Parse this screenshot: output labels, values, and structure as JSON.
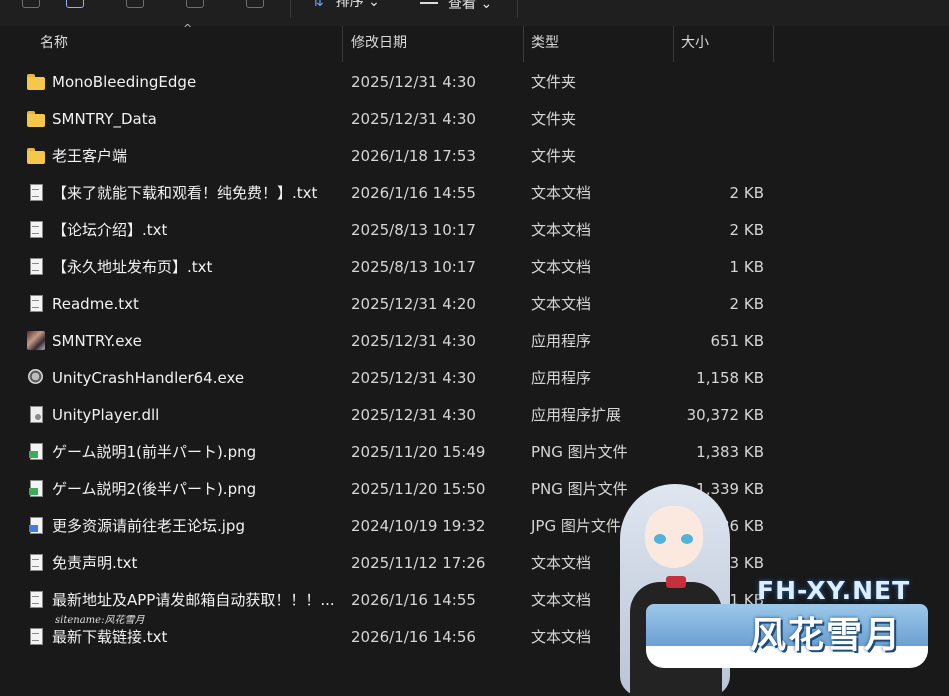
{
  "toolbar": {
    "sort_label": "排序",
    "view_label": "查看",
    "more_label": "···"
  },
  "columns": {
    "name": "名称",
    "date": "修改日期",
    "type": "类型",
    "size": "大小"
  },
  "files": [
    {
      "icon": "folder",
      "name": "MonoBleedingEdge",
      "date": "2025/12/31 4:30",
      "type": "文件夹",
      "size": ""
    },
    {
      "icon": "folder",
      "name": "SMNTRY_Data",
      "date": "2025/12/31 4:30",
      "type": "文件夹",
      "size": ""
    },
    {
      "icon": "folder",
      "name": "老王客户端",
      "date": "2026/1/18 17:53",
      "type": "文件夹",
      "size": ""
    },
    {
      "icon": "text-file",
      "name": "【来了就能下载和观看！纯免费！】.txt",
      "date": "2026/1/16 14:55",
      "type": "文本文档",
      "size": "2 KB"
    },
    {
      "icon": "text-file",
      "name": "【论坛介绍】.txt",
      "date": "2025/8/13 10:17",
      "type": "文本文档",
      "size": "2 KB"
    },
    {
      "icon": "text-file",
      "name": "【永久地址发布页】.txt",
      "date": "2025/8/13 10:17",
      "type": "文本文档",
      "size": "1 KB"
    },
    {
      "icon": "text-file",
      "name": "Readme.txt",
      "date": "2025/12/31 4:20",
      "type": "文本文档",
      "size": "2 KB"
    },
    {
      "icon": "exe",
      "name": "SMNTRY.exe",
      "date": "2025/12/31 4:30",
      "type": "应用程序",
      "size": "651 KB"
    },
    {
      "icon": "unity",
      "name": "UnityCrashHandler64.exe",
      "date": "2025/12/31 4:30",
      "type": "应用程序",
      "size": "1,158 KB"
    },
    {
      "icon": "dll",
      "name": "UnityPlayer.dll",
      "date": "2025/12/31 4:30",
      "type": "应用程序扩展",
      "size": "30,372 KB"
    },
    {
      "icon": "png",
      "name": "ゲーム説明1(前半パート).png",
      "date": "2025/11/20 15:49",
      "type": "PNG 图片文件",
      "size": "1,383 KB"
    },
    {
      "icon": "png",
      "name": "ゲーム説明2(後半パート).png",
      "date": "2025/11/20 15:50",
      "type": "PNG 图片文件",
      "size": "1,339 KB"
    },
    {
      "icon": "jpg",
      "name": "更多资源请前往老王论坛.jpg",
      "date": "2024/10/19 19:32",
      "type": "JPG 图片文件",
      "size": "86 KB"
    },
    {
      "icon": "text-file",
      "name": "免责声明.txt",
      "date": "2025/11/12 17:26",
      "type": "文本文档",
      "size": "3 KB"
    },
    {
      "icon": "text-file",
      "name": "最新地址及APP请发邮箱自动获取！！！...",
      "date": "2026/1/16 14:55",
      "type": "文本文档",
      "size": "1 KB"
    },
    {
      "icon": "text-file",
      "name": "最新下载链接.txt",
      "date": "2026/1/16 14:56",
      "type": "文本文档",
      "size": ""
    }
  ],
  "watermark": {
    "sitename": "sitename:风花雪月",
    "en": "FH-XY.NET",
    "cn": "风花雪月"
  }
}
